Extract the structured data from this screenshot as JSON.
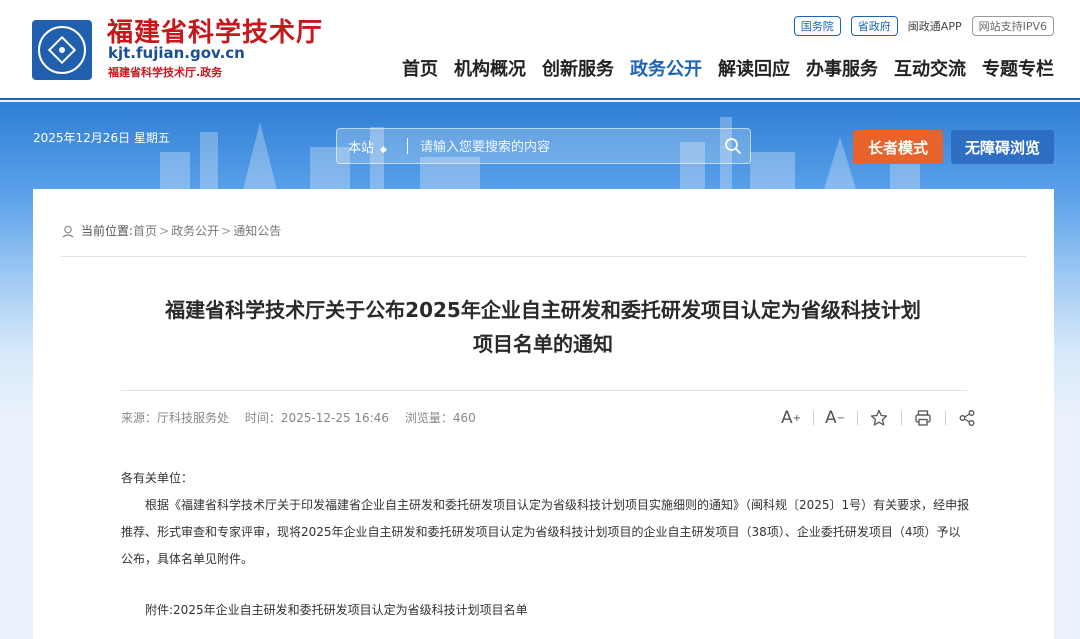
{
  "header": {
    "site_title": "福建省科学技术厅",
    "site_domain": "kjt.fujian.gov.cn",
    "site_subtitle": "福建省科学技术厅.政务",
    "top_links": [
      "国务院",
      "省政府",
      "闽政通APP",
      "网站支持IPV6"
    ],
    "nav": [
      "首页",
      "机构概况",
      "创新服务",
      "政务公开",
      "解读回应",
      "办事服务",
      "互动交流",
      "专题专栏"
    ],
    "active_nav": "政务公开"
  },
  "banner": {
    "date": "2025年12月26日 星期五",
    "search_scope": "本站",
    "search_placeholder": "请输入您要搜索的内容",
    "elder_mode": "长者模式",
    "accessible": "无障碍浏览"
  },
  "breadcrumb": {
    "lead": "当前位置:",
    "items": [
      "首页",
      "政务公开",
      "通知公告"
    ]
  },
  "article": {
    "title_line1": "福建省科学技术厅关于公布2025年企业自主研发和委托研发项目认定为省级科技计划",
    "title_line2": "项目名单的通知",
    "source": "来源：厅科技服务处",
    "time": "时间：2025-12-25 16:46",
    "views": "浏览量：460",
    "tools": [
      "A+",
      "A-",
      "star-icon",
      "print-icon",
      "share-icon"
    ],
    "greeting": "各有关单位：",
    "paragraph": "根据《福建省科学技术厅关于印发福建省企业自主研发和委托研发项目认定为省级科技计划项目实施细则的通知》（闽科规〔2025〕1号）有关要求，经申报推荐、形式审查和专家评审，现将2025年企业自主研发和委托研发项目认定为省级科技计划项目的企业自主研发项目（38项）、企业委托研发项目（4项）予以公布，具体名单见附件。",
    "attachment": "附件:2025年企业自主研发和委托研发项目认定为省级科技计划项目名单"
  },
  "colors": {
    "brand_red": "#c8161d",
    "brand_blue": "#1d63b8",
    "elder_orange": "#e8632b"
  }
}
